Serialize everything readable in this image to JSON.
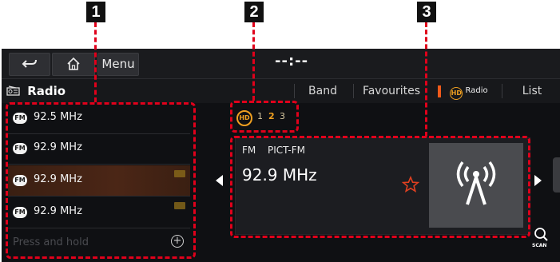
{
  "callouts": [
    "1",
    "2",
    "3"
  ],
  "header": {
    "back_icon": "back-arrow-icon",
    "home_icon": "home-icon",
    "menu_label": "Menu",
    "clock": "--:--"
  },
  "tabbar": {
    "title": "Radio",
    "title_icon": "radio-icon",
    "tabs": [
      "Band",
      "Favourites",
      "List"
    ],
    "hd_radio_label": "Radio"
  },
  "hd_indicator": {
    "logo": "HD",
    "channels": [
      "1",
      "2",
      "3"
    ],
    "active_channel": "2"
  },
  "station_list": {
    "items": [
      {
        "band": "FM",
        "freq": "92.5 MHz",
        "hd": false,
        "selected": false
      },
      {
        "band": "FM",
        "freq": "92.9 MHz",
        "hd": false,
        "selected": false
      },
      {
        "band": "FM",
        "freq": "92.9 MHz",
        "hd": true,
        "selected": true
      },
      {
        "band": "FM",
        "freq": "92.9 MHz",
        "hd": true,
        "selected": false
      }
    ],
    "preset_hint": "Press and hold"
  },
  "now_playing": {
    "band": "FM",
    "station_name": "PICT-FM",
    "freq": "92.9 MHz"
  },
  "scan_label": "SCAN",
  "colors": {
    "accent": "#e0001b",
    "hd_orange": "#f0a020",
    "star": "#e04020"
  }
}
